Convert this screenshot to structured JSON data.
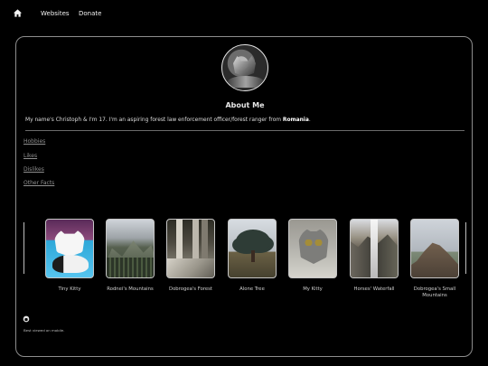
{
  "nav": {
    "home_icon": "home-icon",
    "links": [
      "Websites",
      "Donate"
    ]
  },
  "profile": {
    "title": "About Me",
    "intro_prefix": "My name's Christoph & I'm 17. I'm an aspiring forest law enforcement officer/forest ranger from ",
    "intro_country": "Romania",
    "intro_suffix": "."
  },
  "sections": [
    "Hobbies",
    "Likes",
    "Dislikes",
    "Other Facts"
  ],
  "gallery": [
    {
      "caption": "Tiny Kitty",
      "icon": "cat-photo"
    },
    {
      "caption": "Rodnei's Mountains",
      "icon": "mountain-photo"
    },
    {
      "caption": "Dobrogea's Forest",
      "icon": "forest-photo"
    },
    {
      "caption": "Alone Tree",
      "icon": "tree-photo"
    },
    {
      "caption": "My Kitty",
      "icon": "cat-photo"
    },
    {
      "caption": "Horses' Waterfall",
      "icon": "waterfall-photo"
    },
    {
      "caption": "Dobrogea's Small Mountains",
      "icon": "mountain-photo"
    }
  ],
  "footer": {
    "note": "Best viewed on mobile.",
    "icon": "github-icon"
  }
}
